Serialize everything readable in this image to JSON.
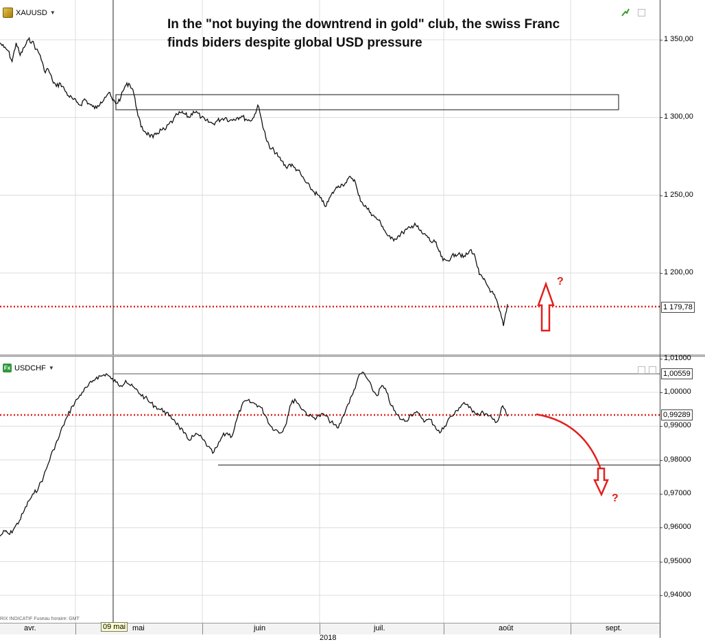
{
  "headline": {
    "line1": "In the \"not buying the downtrend in gold\" club, the swiss Franc",
    "line2": "finds biders despite global USD pressure"
  },
  "top_panel": {
    "symbol": "XAUUSD",
    "axis_labels": [
      "1 350,00",
      "1 300,00",
      "1 250,00",
      "1 200,00"
    ],
    "last_price": "1 179,78",
    "question_mark": "?"
  },
  "bottom_panel": {
    "symbol": "USDCHF",
    "symbol_icon": "Fx",
    "axis_labels": [
      "1,01000",
      "1,00000",
      "0,99000",
      "0,98000",
      "0,97000",
      "0,96000",
      "0,95000",
      "0,94000"
    ],
    "high_price": "1,00559",
    "last_price": "0,99289",
    "question_mark": "?"
  },
  "date_axis": {
    "months": [
      "avr.",
      "mai",
      "juin",
      "juil.",
      "août",
      "sept."
    ],
    "crosshair_label": "09 mai",
    "year_partial": "2018"
  },
  "footer_note": "RIX INDICATIF   Fuseau horaire: GMT",
  "colors": {
    "price_line": "#111111",
    "level_line": "#e0201c",
    "arrow": "#e0201c"
  },
  "chart_data": [
    {
      "type": "line",
      "title": "XAUUSD",
      "series": [
        {
          "name": "XAUUSD",
          "values": [
            1348,
            1345,
            1343,
            1336,
            1348,
            1340,
            1345,
            1350,
            1349,
            1344,
            1340,
            1330,
            1331,
            1324,
            1320,
            1322,
            1318,
            1314,
            1312,
            1310,
            1308,
            1312,
            1309,
            1307,
            1306,
            1310,
            1313,
            1316,
            1311,
            1309,
            1313,
            1320,
            1322,
            1318,
            1305,
            1294,
            1291,
            1289,
            1287,
            1290,
            1292,
            1292,
            1296,
            1298,
            1302,
            1303,
            1302,
            1300,
            1304,
            1303,
            1300,
            1298,
            1297,
            1296,
            1298,
            1299,
            1300,
            1298,
            1299,
            1300,
            1301,
            1299,
            1298,
            1300,
            1308,
            1298,
            1287,
            1280,
            1279,
            1275,
            1272,
            1268,
            1270,
            1268,
            1266,
            1262,
            1258,
            1255,
            1252,
            1250,
            1246,
            1243,
            1249,
            1253,
            1256,
            1257,
            1258,
            1262,
            1260,
            1250,
            1245,
            1242,
            1239,
            1236,
            1234,
            1230,
            1225,
            1222,
            1222,
            1224,
            1226,
            1228,
            1229,
            1232,
            1228,
            1225,
            1224,
            1220,
            1220,
            1214,
            1208,
            1208,
            1210,
            1212,
            1213,
            1210,
            1212,
            1215,
            1210,
            1199,
            1196,
            1192,
            1188,
            1184,
            1176,
            1166,
            1180
          ]
        }
      ],
      "ylim": [
        1150,
        1370
      ],
      "annotations": [
        "rectangle resistance zone 1303-1313",
        "horizontal red dotted level 1179.78",
        "red up arrow with question mark"
      ]
    },
    {
      "type": "line",
      "title": "USDCHF",
      "series": [
        {
          "name": "USDCHF",
          "values": [
            0.9575,
            0.959,
            0.958,
            0.96,
            0.962,
            0.965,
            0.968,
            0.97,
            0.972,
            0.975,
            0.979,
            0.983,
            0.986,
            0.99,
            0.993,
            0.996,
            0.998,
            1.0,
            1.0015,
            1.003,
            1.0045,
            1.0048,
            1.0055,
            1.004,
            1.003,
            1.002,
            1.0035,
            1.002,
            1.001,
            0.9995,
            0.9985,
            0.997,
            0.996,
            0.995,
            0.9945,
            0.993,
            0.992,
            0.99,
            0.988,
            0.986,
            0.987,
            0.9875,
            0.986,
            0.984,
            0.982,
            0.984,
            0.987,
            0.988,
            0.987,
            0.992,
            0.996,
            0.9975,
            0.997,
            0.9965,
            0.9955,
            0.993,
            0.99,
            0.989,
            0.988,
            0.99,
            0.996,
            0.998,
            0.996,
            0.9945,
            0.993,
            0.9925,
            0.993,
            0.9935,
            0.992,
            0.9905,
            0.9895,
            0.993,
            0.9965,
            0.9995,
            1.004,
            1.006,
            1.004,
            1.001,
            0.999,
            1.002,
            1.0,
            0.996,
            0.9935,
            0.992,
            0.9915,
            0.9935,
            0.994,
            0.993,
            0.9915,
            0.992,
            0.99,
            0.988,
            0.99,
            0.9925,
            0.9935,
            0.9955,
            0.997,
            0.9955,
            0.9945,
            0.9935,
            0.994,
            0.993,
            0.992,
            0.9915,
            0.996,
            0.9929
          ]
        }
      ],
      "ylim": [
        0.938,
        1.011
      ],
      "annotations": [
        "horizontal red dotted level 0.99289",
        "support line at 0.9782",
        "curved red arrow pointing down with question mark"
      ]
    }
  ]
}
